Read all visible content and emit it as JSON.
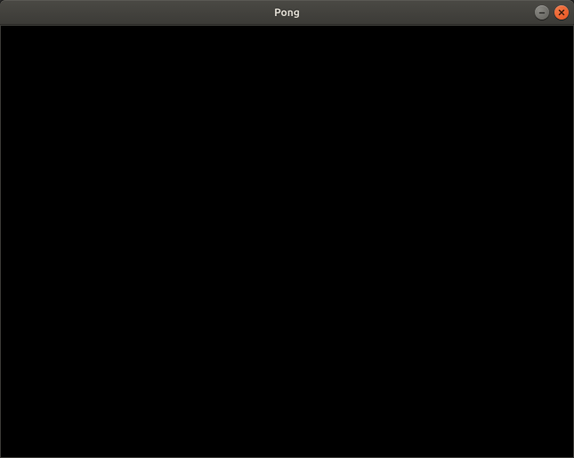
{
  "window": {
    "title": "Pong"
  },
  "controls": {
    "minimize_tooltip": "Minimize",
    "close_tooltip": "Close"
  },
  "game": {
    "state": "blank"
  }
}
